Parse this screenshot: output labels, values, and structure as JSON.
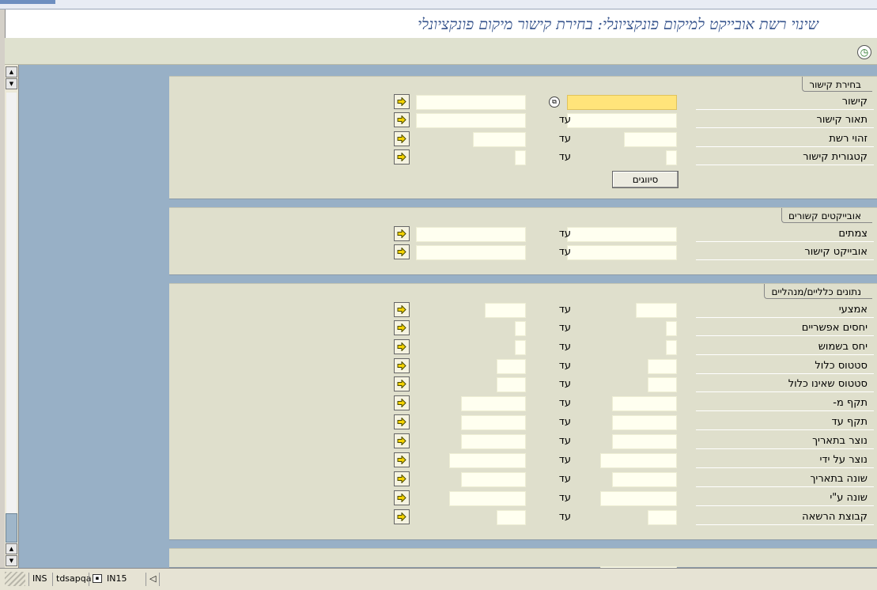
{
  "title": "שינוי רשת אובייקט למיקום פונקציונלי: בחירת קישור מיקום פונקציונלי",
  "toolbar": {
    "execute_icon": "execute-clock-icon"
  },
  "to_text": "עד",
  "sections": {
    "link_selection": {
      "title": "בחירת קישור",
      "rows": [
        {
          "label": "קישור"
        },
        {
          "label": "תאור קישור"
        },
        {
          "label": "זהוי רשת"
        },
        {
          "label": "קטגורית קישור"
        }
      ],
      "button_label": "סיווגים"
    },
    "linked_objects": {
      "title": "אובייקטים קשורים",
      "rows": [
        {
          "label": "צמתים"
        },
        {
          "label": "אובייקט קישור"
        }
      ]
    },
    "general_data": {
      "title": "נתונים כלליים/מנהליים",
      "rows": [
        {
          "label": "אמצעי"
        },
        {
          "label": "יחסים אפשריים"
        },
        {
          "label": "יחס בשמוש"
        },
        {
          "label": "סטטוס כלול"
        },
        {
          "label": "סטטוס שאינו כלול"
        },
        {
          "label": "תקף מ-"
        },
        {
          "label": "תקף עד"
        },
        {
          "label": "נוצר בתאריך"
        },
        {
          "label": "נוצר על ידי"
        },
        {
          "label": "שונה בתאריך"
        },
        {
          "label": "שונה ע\"י"
        },
        {
          "label": "קבוצת הרשאה"
        }
      ]
    }
  },
  "status_bar": {
    "mode": "INS",
    "server": "tdsapqa",
    "session": "IN15"
  }
}
